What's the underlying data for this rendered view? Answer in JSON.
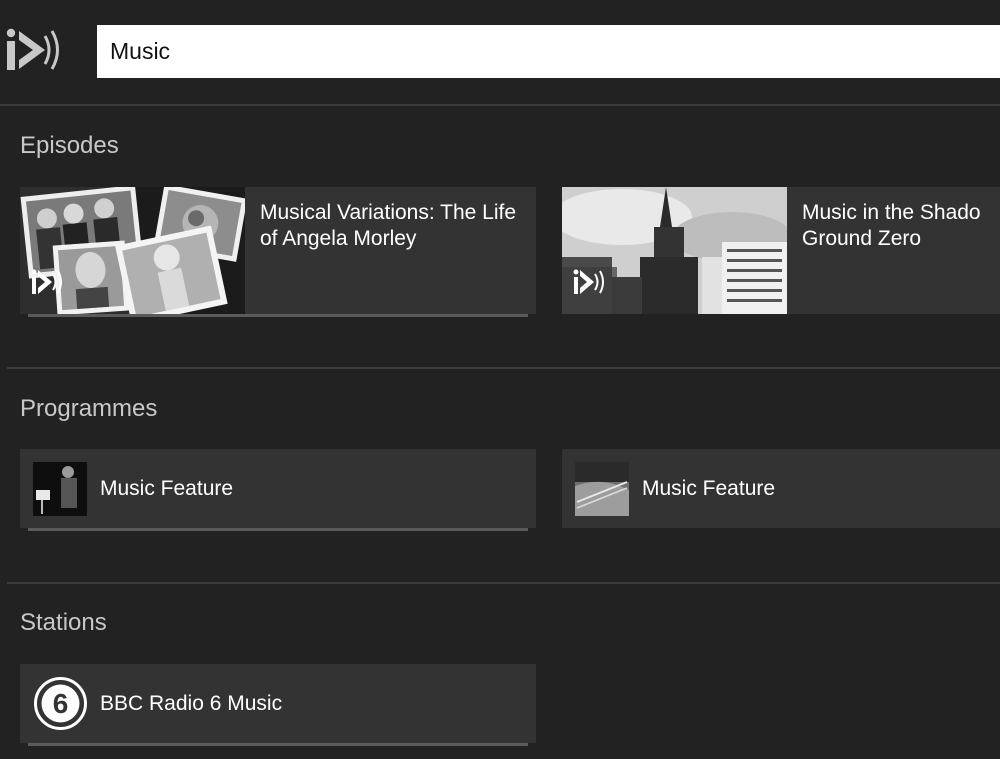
{
  "header": {
    "logo_icon": "bbc-iplayer-radio-icon",
    "search": {
      "value": "Music"
    }
  },
  "sections": {
    "episodes": {
      "title": "Episodes",
      "items": [
        {
          "title": "Musical Variations: The Life of Angela Morley",
          "badge_icon": "iplayer-radio-icon"
        },
        {
          "title": "Music in the Shadow of Ground Zero",
          "title_line1": "Music in the Shado",
          "title_line2": "Ground Zero",
          "badge_icon": "iplayer-radio-icon"
        }
      ]
    },
    "programmes": {
      "title": "Programmes",
      "items": [
        {
          "title": "Music Feature"
        },
        {
          "title": "Music Feature"
        }
      ]
    },
    "stations": {
      "title": "Stations",
      "items": [
        {
          "title": "BBC Radio 6 Music",
          "icon": "bbc-radio-6-logo-icon",
          "icon_text": "6"
        }
      ]
    }
  },
  "colors": {
    "background": "#222222",
    "card": "#333333",
    "divider": "#3c3c3c",
    "section_title": "#c8c8c8",
    "text": "#ffffff",
    "search_bg": "#ffffff"
  }
}
